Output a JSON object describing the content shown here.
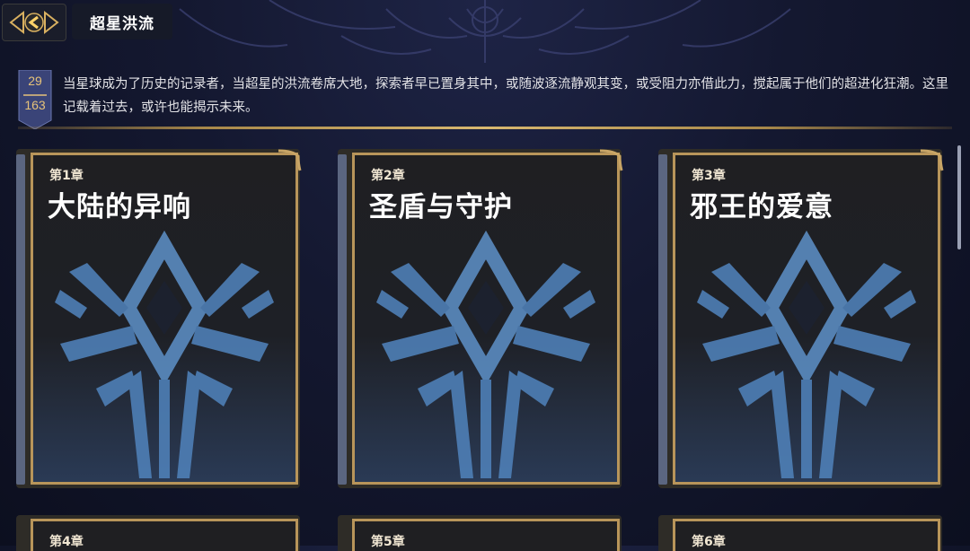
{
  "header": {
    "back_icon": "arrow-left-icon",
    "title": "超星洪流"
  },
  "progress": {
    "current": "29",
    "total": "163"
  },
  "description": "当星球成为了历史的记录者，当超星的洪流卷席大地，探索者早已置身其中，或随波逐流静观其变，或受阻力亦借此力，搅起属于他们的超进化狂潮。这里记载着过去，或许也能揭示未来。",
  "chapters": [
    {
      "number": "第1章",
      "title": "大陆的异响"
    },
    {
      "number": "第2章",
      "title": "圣盾与守护"
    },
    {
      "number": "第3章",
      "title": "邪王的爱意"
    }
  ],
  "next_chapters": [
    {
      "number": "第4章"
    },
    {
      "number": "第5章"
    },
    {
      "number": "第6章"
    }
  ],
  "colors": {
    "gold": "#b8955a",
    "emblem_blue": "#5a8bc0",
    "background": "#141830"
  }
}
